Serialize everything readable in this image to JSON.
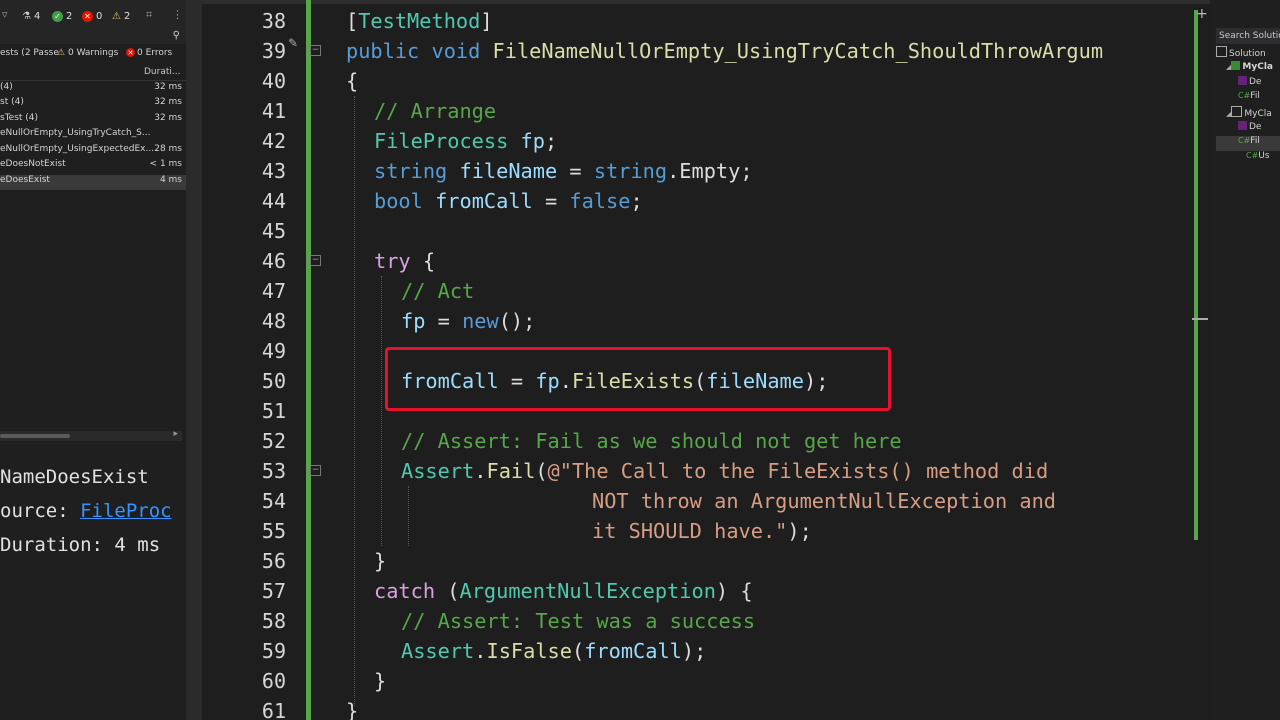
{
  "test_explorer": {
    "badges": {
      "total": "4",
      "passed": "2",
      "failed": "0",
      "warnings": "2"
    },
    "summary": {
      "tests": "ests (2 Passe",
      "warnings": "0 Warnings",
      "errors": "0 Errors"
    },
    "header": {
      "duration": "Durati..."
    },
    "rows": [
      {
        "name": "(4)",
        "duration": "32 ms"
      },
      {
        "name": "st (4)",
        "duration": "32 ms"
      },
      {
        "name": "sTest (4)",
        "duration": "32 ms"
      },
      {
        "name": "eNullOrEmpty_UsingTryCatch_S...",
        "duration": ""
      },
      {
        "name": "eNullOrEmpty_UsingExpectedEx...",
        "duration": "28 ms"
      },
      {
        "name": "eDoesNotExist",
        "duration": "< 1 ms"
      },
      {
        "name": "eDoesExist",
        "duration": "4 ms"
      }
    ],
    "detail": {
      "name": "NameDoesExist",
      "source_label": "ource:",
      "source_link": "FileProc",
      "duration": "Duration: 4 ms"
    }
  },
  "editor": {
    "line_numbers": [
      "38",
      "39",
      "40",
      "41",
      "42",
      "43",
      "44",
      "45",
      "46",
      "47",
      "48",
      "49",
      "50",
      "51",
      "52",
      "53",
      "54",
      "55",
      "56",
      "57",
      "58",
      "59",
      "60",
      "61"
    ],
    "code": {
      "l38": {
        "attr_open": "[",
        "attr": "TestMethod",
        "attr_close": "]"
      },
      "l39": {
        "kw1": "public",
        "kw2": "void",
        "method": "FileNameNullOrEmpty_UsingTryCatch_ShouldThrowArgum"
      },
      "l40": "{",
      "l41": "// Arrange",
      "l42": {
        "type": "FileProcess",
        "var": "fp",
        "end": ";"
      },
      "l43": {
        "kw": "string",
        "var": "fileName",
        "eq": " = ",
        "kw2": "string",
        "rest": ".Empty;"
      },
      "l44": {
        "kw": "bool",
        "var": "fromCall",
        "eq": " = ",
        "val": "false",
        "end": ";"
      },
      "l46": {
        "kw": "try",
        "rest": " {"
      },
      "l47": "// Act",
      "l48": {
        "var": "fp",
        "eq": " = ",
        "kw": "new",
        "rest": "();"
      },
      "l50": {
        "var": "fromCall",
        "eq": " = ",
        "obj": "fp",
        "dot": ".",
        "fn": "FileExists",
        "po": "(",
        "arg": "fileName",
        "pc": ");"
      },
      "l52": "// Assert: Fail as we should not get here",
      "l53": {
        "cls": "Assert",
        "dot": ".",
        "fn": "Fail",
        "po": "(",
        "str": "@\"The Call to the FileExists() method did"
      },
      "l54": "NOT throw an ArgumentNullException and",
      "l55": {
        "str": "it SHOULD have.\"",
        "end": ");"
      },
      "l56": "}",
      "l57": {
        "kw": "catch",
        "po": " (",
        "type": "ArgumentNullException",
        "rest": ") {"
      },
      "l58": "// Assert: Test was a success",
      "l59": {
        "cls": "Assert",
        "dot": ".",
        "fn": "IsFalse",
        "po": "(",
        "arg": "fromCall",
        "pc": ");"
      },
      "l60": "}",
      "l61": "}"
    }
  },
  "solution_explorer": {
    "search": "Search Solution",
    "rows": [
      "Solution",
      "MyCla",
      "De",
      "Fil",
      "MyCla",
      "De",
      "Fil",
      "Us"
    ]
  }
}
